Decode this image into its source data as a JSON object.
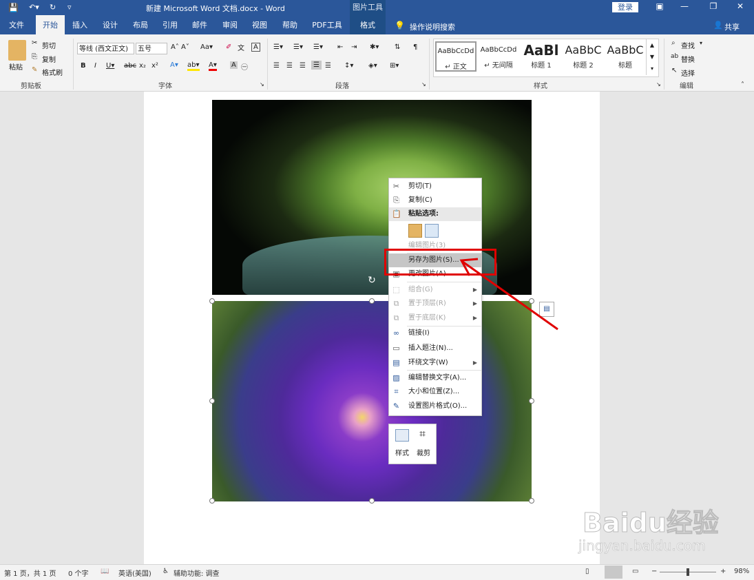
{
  "app": {
    "doc_title": "新建 Microsoft Word 文档.docx  -  Word",
    "context_tab": "图片工具",
    "login": "登录"
  },
  "tabs": [
    "文件",
    "开始",
    "插入",
    "设计",
    "布局",
    "引用",
    "邮件",
    "审阅",
    "视图",
    "帮助",
    "PDF工具",
    "格式"
  ],
  "tell_me": "操作说明搜索",
  "share": "共享",
  "ribbon": {
    "clipboard": {
      "paste": "粘贴",
      "cut": "剪切",
      "copy": "复制",
      "painter": "格式刷",
      "label": "剪贴板"
    },
    "font": {
      "name": "等线 (西文正文)",
      "size": "五号",
      "label": "字体"
    },
    "paragraph": {
      "label": "段落"
    },
    "styles": {
      "label": "样式",
      "items": [
        {
          "preview": "AaBbCcDd",
          "name": "↵ 正文"
        },
        {
          "preview": "AaBbCcDd",
          "name": "↵ 无间隔"
        },
        {
          "preview": "AaBl",
          "name": "标题 1"
        },
        {
          "preview": "AaBbC",
          "name": "标题 2"
        },
        {
          "preview": "AaBbC",
          "name": "标题"
        }
      ]
    },
    "editing": {
      "find": "查找",
      "replace": "替换",
      "select": "选择",
      "label": "编辑"
    }
  },
  "context_menu": {
    "items": [
      {
        "label": "剪切(T)",
        "icon": "scissors-icon",
        "state": "normal"
      },
      {
        "label": "复制(C)",
        "icon": "copy-icon",
        "state": "normal"
      },
      {
        "label": "粘贴选项:",
        "icon": "paste-icon",
        "state": "header"
      },
      {
        "label": "编辑图片(3)",
        "icon": "",
        "state": "disabled"
      },
      {
        "label": "另存为图片(S)...",
        "icon": "",
        "state": "highlight"
      },
      {
        "label": "更改图片(A)",
        "icon": "change-picture-icon",
        "state": "normal"
      },
      {
        "label": "组合(G)",
        "icon": "group-icon",
        "state": "disabled"
      },
      {
        "label": "置于顶层(R)",
        "icon": "bring-front-icon",
        "state": "disabled"
      },
      {
        "label": "置于底层(K)",
        "icon": "send-back-icon",
        "state": "disabled"
      },
      {
        "label": "链接(I)",
        "icon": "link-icon",
        "state": "normal"
      },
      {
        "label": "插入题注(N)...",
        "icon": "caption-icon",
        "state": "normal"
      },
      {
        "label": "环绕文字(W)",
        "icon": "wrap-icon",
        "state": "normal"
      },
      {
        "label": "编辑替换文字(A)...",
        "icon": "alt-text-icon",
        "state": "normal"
      },
      {
        "label": "大小和位置(Z)...",
        "icon": "size-icon",
        "state": "normal"
      },
      {
        "label": "设置图片格式(O)...",
        "icon": "format-picture-icon",
        "state": "normal"
      }
    ]
  },
  "mini_toolbar": {
    "style": "样式",
    "crop": "裁剪"
  },
  "status": {
    "page": "第 1 页，共 1 页",
    "words": "0 个字",
    "language": "英语(美国)",
    "accessibility": "辅助功能: 调查",
    "zoom": "98%"
  },
  "watermark": {
    "brand": "Baidu经验",
    "url": "jingyan.baidu.com"
  }
}
